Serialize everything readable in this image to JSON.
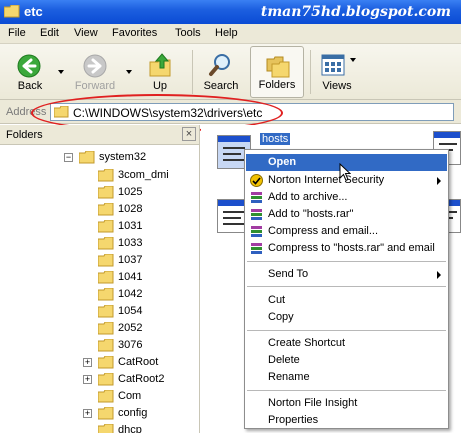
{
  "window": {
    "title": "etc",
    "watermark": "tman75hd.blogspot.com"
  },
  "menu": {
    "items": [
      "File",
      "Edit",
      "View",
      "Favorites",
      "Tools",
      "Help"
    ]
  },
  "toolbar": {
    "back_label": "Back",
    "forward_label": "Forward",
    "up_label": "Up",
    "search_label": "Search",
    "folders_label": "Folders",
    "views_label": "Views"
  },
  "address": {
    "label": "Address",
    "path": "C:\\WINDOWS\\system32\\drivers\\etc"
  },
  "folders_pane": {
    "title": "Folders",
    "close_glyph": "×",
    "tree": [
      {
        "label": "system32",
        "expander": "−"
      },
      {
        "label": "3com_dmi",
        "expander": ""
      },
      {
        "label": "1025",
        "expander": ""
      },
      {
        "label": "1028",
        "expander": ""
      },
      {
        "label": "1031",
        "expander": ""
      },
      {
        "label": "1033",
        "expander": ""
      },
      {
        "label": "1037",
        "expander": ""
      },
      {
        "label": "1041",
        "expander": ""
      },
      {
        "label": "1042",
        "expander": ""
      },
      {
        "label": "1054",
        "expander": ""
      },
      {
        "label": "2052",
        "expander": ""
      },
      {
        "label": "3076",
        "expander": ""
      },
      {
        "label": "CatRoot",
        "expander": "+"
      },
      {
        "label": "CatRoot2",
        "expander": "+"
      },
      {
        "label": "Com",
        "expander": ""
      },
      {
        "label": "config",
        "expander": "+"
      },
      {
        "label": "dhcp",
        "expander": ""
      }
    ]
  },
  "content": {
    "selected_file": "hosts"
  },
  "context_menu": {
    "items": [
      {
        "label": "Open",
        "icon": "",
        "submenu": false
      },
      {
        "label": "Norton Internet Security",
        "icon": "norton-icon",
        "submenu": true
      },
      {
        "label": "Add to archive...",
        "icon": "winrar-icon",
        "submenu": false
      },
      {
        "label": "Add to \"hosts.rar\"",
        "icon": "winrar-icon",
        "submenu": false
      },
      {
        "label": "Compress and email...",
        "icon": "winrar-icon",
        "submenu": false
      },
      {
        "label": "Compress to \"hosts.rar\" and email",
        "icon": "winrar-icon",
        "submenu": false
      },
      {
        "label": "Send To",
        "icon": "",
        "submenu": true
      },
      {
        "label": "Cut",
        "icon": "",
        "submenu": false
      },
      {
        "label": "Copy",
        "icon": "",
        "submenu": false
      },
      {
        "label": "Create Shortcut",
        "icon": "",
        "submenu": false
      },
      {
        "label": "Delete",
        "icon": "",
        "submenu": false
      },
      {
        "label": "Rename",
        "icon": "",
        "submenu": false
      },
      {
        "label": "Norton File Insight",
        "icon": "",
        "submenu": false
      },
      {
        "label": "Properties",
        "icon": "",
        "submenu": false
      }
    ]
  },
  "colors": {
    "title_bar": "#0a4bd4",
    "highlight": "#316ac5",
    "annotation_oval": "#e02020",
    "chrome": "#ece9d8"
  }
}
